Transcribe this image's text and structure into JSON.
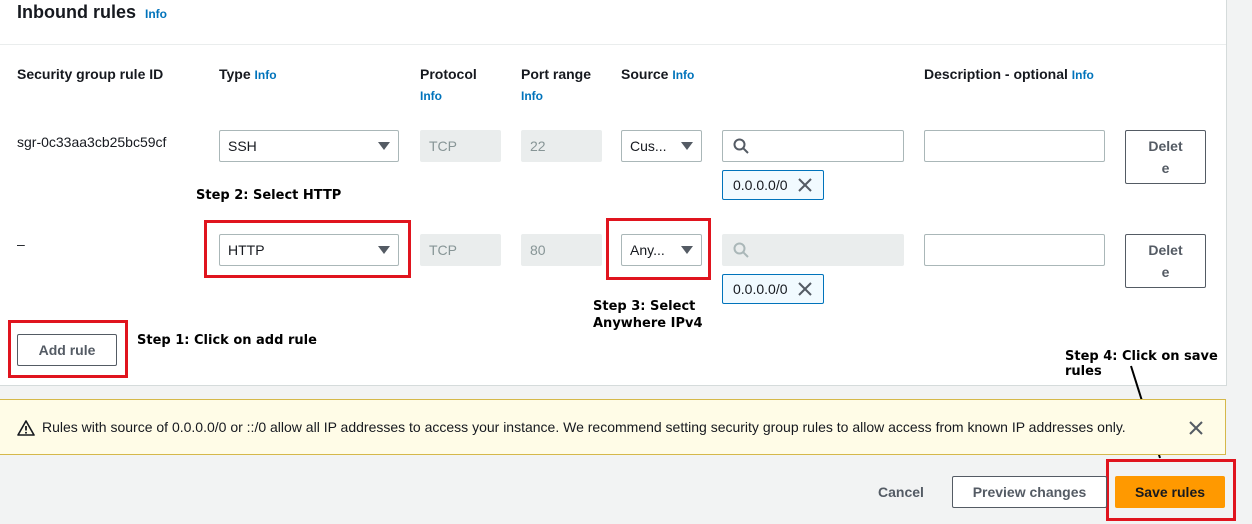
{
  "header": {
    "title": "Inbound rules",
    "info": "Info"
  },
  "columns": {
    "rule_id": "Security group rule ID",
    "type": "Type",
    "type_info": "Info",
    "protocol": "Protocol",
    "protocol_info": "Info",
    "port_range": "Port range",
    "port_info": "Info",
    "source": "Source",
    "source_info": "Info",
    "description": "Description - optional",
    "description_info": "Info"
  },
  "rows": [
    {
      "rule_id": "sgr-0c33aa3cb25bc59cf",
      "type": "SSH",
      "protocol": "TCP",
      "port": "22",
      "source": "Cus...",
      "cidr": "0.0.0.0/0",
      "delete_line1": "Delet",
      "delete_line2": "e"
    },
    {
      "rule_id": "–",
      "type": "HTTP",
      "protocol": "TCP",
      "port": "80",
      "source": "Any...",
      "cidr": "0.0.0.0/0",
      "delete_line1": "Delet",
      "delete_line2": "e"
    }
  ],
  "add_rule": "Add rule",
  "annotations": {
    "step1": "Step 1: Click on add rule",
    "step2": "Step 2: Select HTTP",
    "step3_line1": "Step 3: Select",
    "step3_line2": "Anywhere IPv4",
    "step4": "Step 4: Click on save rules"
  },
  "alert": {
    "text": "Rules with source of 0.0.0.0/0 or ::/0 allow all IP addresses to access your instance. We recommend setting security group rules to allow access from known IP addresses only."
  },
  "footer": {
    "cancel": "Cancel",
    "preview": "Preview changes",
    "save": "Save rules"
  },
  "colors": {
    "accent": "#ff9900",
    "link": "#0073bb",
    "highlight": "#e0141e"
  }
}
